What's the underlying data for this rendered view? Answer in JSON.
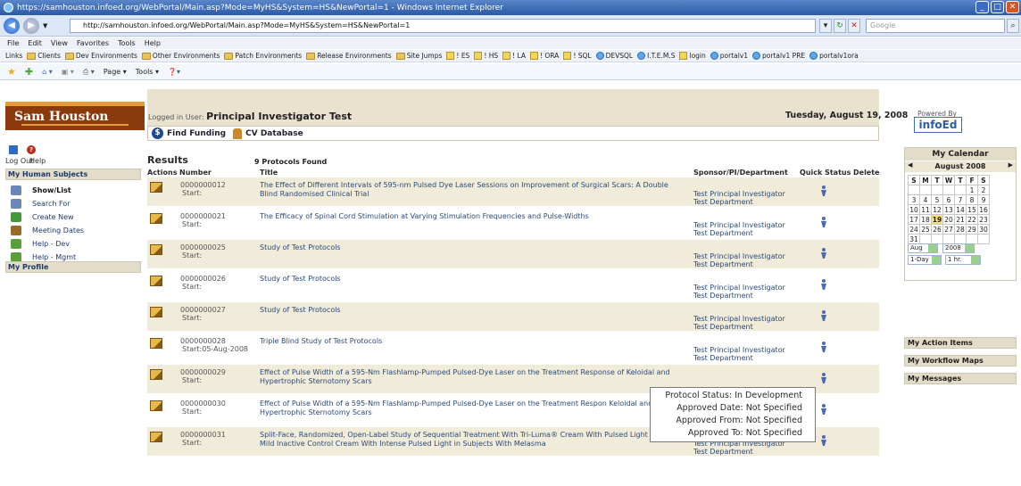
{
  "browser": {
    "title": "https://samhouston.infoed.org/WebPortal/Main.asp?Mode=MyHS&System=HS&NewPortal=1 - Windows Internet Explorer",
    "url": "http://samhouston.infoed.org/WebPortal/Main.asp?Mode=MyHS&System=HS&NewPortal=1",
    "search_placeholder": "Google",
    "menu": [
      "File",
      "Edit",
      "View",
      "Favorites",
      "Tools",
      "Help"
    ],
    "links_label": "Links",
    "links": [
      {
        "label": "Clients",
        "icon": "folder-icon"
      },
      {
        "label": "Dev Environments",
        "icon": "folder-icon"
      },
      {
        "label": "Other Environments",
        "icon": "folder-icon"
      },
      {
        "label": "Patch Environments",
        "icon": "folder-icon"
      },
      {
        "label": "Release Environments",
        "icon": "folder-icon"
      },
      {
        "label": "Site Jumps",
        "icon": "folder-icon"
      },
      {
        "label": "! ES",
        "icon": "page-icon"
      },
      {
        "label": "! HS",
        "icon": "page-icon"
      },
      {
        "label": "! LA",
        "icon": "page-icon"
      },
      {
        "label": "! ORA",
        "icon": "page-icon"
      },
      {
        "label": "! SQL",
        "icon": "page-icon"
      },
      {
        "label": "DEVSQL",
        "icon": "ie-icon"
      },
      {
        "label": "I.T.E.M.S",
        "icon": "ie-icon"
      },
      {
        "label": "login",
        "icon": "page-icon"
      },
      {
        "label": "portalv1",
        "icon": "ie-icon"
      },
      {
        "label": "portalv1 PRE",
        "icon": "ie-icon"
      },
      {
        "label": "portalv1ora",
        "icon": "ie-icon"
      }
    ],
    "commands": [
      "Page",
      "Tools"
    ]
  },
  "header": {
    "logo_text": "Sam Houston",
    "logged_in_label": "Logged in User:",
    "logged_in_user": "Principal Investigator Test",
    "date": "Tuesday, August 19, 2008",
    "find_funding": "Find Funding",
    "cv_database": "CV Database",
    "powered_by": "Powered By",
    "brand": "infoEd"
  },
  "sidebar": {
    "logout": "Log Out",
    "help": "Help",
    "section_title": "My Human Subjects",
    "items": [
      {
        "label": "Show/List",
        "active": true,
        "color": "#6b87b8"
      },
      {
        "label": "Search For",
        "active": false,
        "color": "#6b87b8"
      },
      {
        "label": "Create New",
        "active": false,
        "color": "#3f9a3a"
      },
      {
        "label": "Meeting Dates",
        "active": false,
        "color": "#9a6a2a"
      },
      {
        "label": "Help - Dev",
        "active": false,
        "color": "#5aa03a"
      },
      {
        "label": "Help - Mgmt",
        "active": false,
        "color": "#5aa03a"
      }
    ],
    "profile": "My Profile"
  },
  "results": {
    "title": "Results",
    "count_text": "9 Protocols Found",
    "columns": {
      "actions": "Actions",
      "number": "Number",
      "title": "Title",
      "sponsor": "Sponsor/PI/Department",
      "quick_status": "Quick Status",
      "delete": "Delete"
    },
    "rows": [
      {
        "number": "0000000012",
        "start": "Start:",
        "title": "The Effect of Different Intervals of 595-nm Pulsed Dye Laser Sessions on Improvement of Surgical Scars: A Double Blind Randomised Clinical Trial",
        "pi": "Test Principal Investigator",
        "dept": "Test Department"
      },
      {
        "number": "0000000021",
        "start": "Start:",
        "title": "The Efficacy of Spinal Cord Stimulation at Varying Stimulation Frequencies and Pulse-Widths",
        "pi": "Test Principal Investigator",
        "dept": "Test Department"
      },
      {
        "number": "0000000025",
        "start": "Start:",
        "title": "Study of Test Protocols",
        "pi": "Test Principal Investigator",
        "dept": "Test Department"
      },
      {
        "number": "0000000026",
        "start": "Start:",
        "title": "Study of Test Protocols",
        "pi": "Test Principal Investigator",
        "dept": "Test Department"
      },
      {
        "number": "0000000027",
        "start": "Start:",
        "title": "Study of Test Protocols",
        "pi": "Test Principal Investigator",
        "dept": "Test Department"
      },
      {
        "number": "0000000028",
        "start": "Start:05-Aug-2008",
        "title": "Triple Blind Study of Test Protocols",
        "pi": "Test Principal Investigator",
        "dept": "Test Department"
      },
      {
        "number": "0000000029",
        "start": "Start:",
        "title": "Effect of Pulse Width of a 595-Nm Flashlamp-Pumped Pulsed-Dye Laser on the Treatment Response of Keloidal and Hypertrophic Sternotomy Scars",
        "pi": "",
        "dept": ""
      },
      {
        "number": "0000000030",
        "start": "Start:",
        "title": "Effect of Pulse Width of a 595-Nm Flashlamp-Pumped Pulsed-Dye Laser on the Treatment Respon Keloidal and Hypertrophic Sternotomy Scars",
        "pi": "",
        "dept": ""
      },
      {
        "number": "0000000031",
        "start": "Start:",
        "title": "Split-Face, Randomized, Open-Label Study of Sequential Treatment With Tri-Luma® Cream With Pulsed Light vs. a Mild Inactive Control Cream With Intense Pulsed Light in Subjects With Melasma",
        "pi": "Test Principal Investigator",
        "dept": "Test Department"
      }
    ]
  },
  "tooltip": {
    "status": "Protocol Status: In Development",
    "approved_date": "Approved Date: Not Specified",
    "approved_from": "Approved From: Not Specified",
    "approved_to": "Approved To: Not Specified"
  },
  "calendar": {
    "title": "My Calendar",
    "month": "August 2008",
    "weekdays": [
      "S",
      "M",
      "T",
      "W",
      "T",
      "F",
      "S"
    ],
    "weeks": [
      [
        "",
        "",
        "",
        "",
        "",
        "1",
        "2"
      ],
      [
        "3",
        "4",
        "5",
        "6",
        "7",
        "8",
        "9"
      ],
      [
        "10",
        "11",
        "12",
        "13",
        "14",
        "15",
        "16"
      ],
      [
        "17",
        "18",
        "19",
        "20",
        "21",
        "22",
        "23"
      ],
      [
        "24",
        "25",
        "26",
        "27",
        "28",
        "29",
        "30"
      ],
      [
        "31",
        "",
        "",
        "",
        "",
        "",
        ""
      ]
    ],
    "today": "19",
    "month_select": "Aug",
    "year_select": "2008",
    "view_select": "1-Day",
    "interval_select": "1 hr."
  },
  "right_panels": [
    "My Action Items",
    "My Workflow Maps",
    "My Messages"
  ]
}
